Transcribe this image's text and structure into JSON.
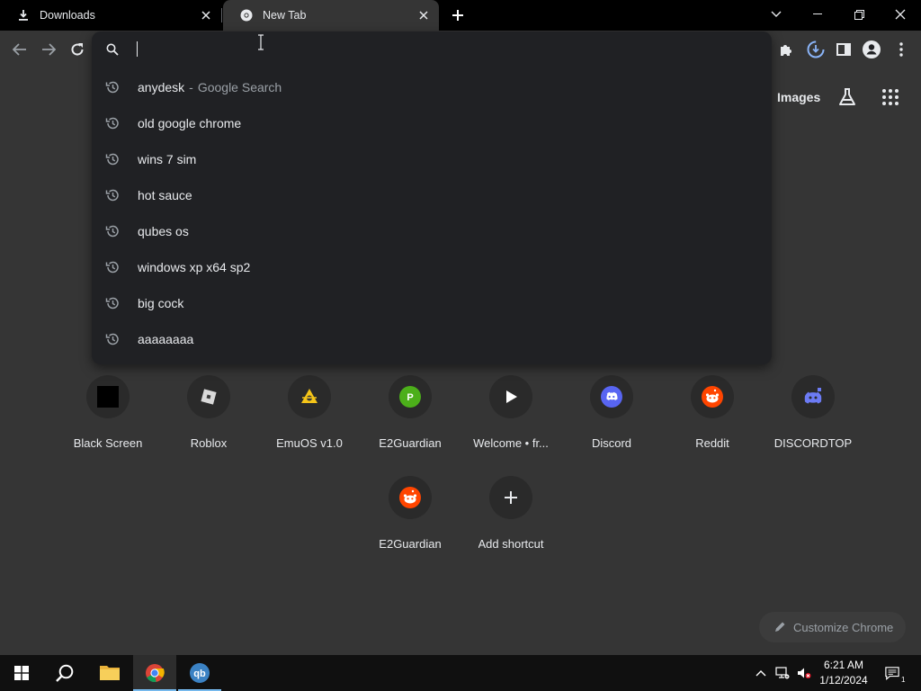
{
  "tabs": [
    {
      "title": "Downloads",
      "icon": "download-icon"
    },
    {
      "title": "New Tab",
      "icon": "chrome-icon",
      "active": true
    }
  ],
  "omnibox": {
    "value": "",
    "suggestions": [
      {
        "text": "anydesk",
        "separator": "-",
        "source": "Google Search"
      },
      {
        "text": "old google chrome"
      },
      {
        "text": "wins 7 sim"
      },
      {
        "text": "hot sauce"
      },
      {
        "text": "qubes os"
      },
      {
        "text": "windows xp x64 sp2"
      },
      {
        "text": "big cock"
      },
      {
        "text": "aaaaaaaa"
      }
    ]
  },
  "header": {
    "images_link": "Images"
  },
  "shortcuts": [
    {
      "label": "Black Screen",
      "icon": "black-square-icon"
    },
    {
      "label": "Roblox",
      "icon": "roblox-icon"
    },
    {
      "label": "EmuOS v1.0",
      "icon": "emuos-icon"
    },
    {
      "label": "E2Guardian",
      "icon": "letter-p-icon",
      "letter": "P"
    },
    {
      "label": "Welcome • fr...",
      "icon": "play-icon"
    },
    {
      "label": "Discord",
      "icon": "discord-icon"
    },
    {
      "label": "Reddit",
      "icon": "reddit-icon"
    },
    {
      "label": "DISCORDTOP",
      "icon": "discord-bot-icon"
    },
    {
      "label": "E2Guardian",
      "icon": "reddit-icon"
    },
    {
      "label": "Add shortcut",
      "icon": "plus-icon"
    }
  ],
  "customize_chrome": "Customize Chrome",
  "taskbar": {
    "time": "6:21 AM",
    "date": "1/12/2024",
    "notification_count": "1",
    "apps": [
      "start-icon",
      "search-icon",
      "file-explorer-icon",
      "chrome-icon",
      "qbittorrent-icon"
    ]
  },
  "colors": {
    "page_bg": "#353535",
    "dropdown_bg": "#202124",
    "accent_blue": "#8ab4f8",
    "reddit_orange": "#ff4500",
    "discord_blurple": "#5865f2"
  }
}
